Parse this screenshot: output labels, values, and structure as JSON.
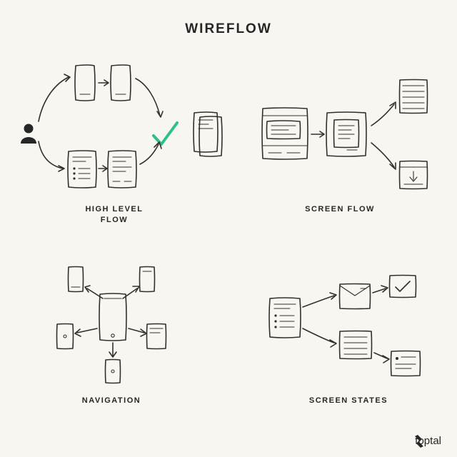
{
  "title": "WIREFLOW",
  "sections": {
    "high_level_flow": {
      "label": "HIGH LEVEL\nFLOW"
    },
    "screen_flow": {
      "label": "SCREEN FLOW"
    },
    "navigation": {
      "label": "NAVIGATION"
    },
    "screen_states": {
      "label": "SCREEN STATES"
    }
  },
  "brand": "toptal",
  "colors": {
    "ink": "#303030",
    "accent": "#2fbf8a",
    "bg": "#f8f6f1"
  }
}
